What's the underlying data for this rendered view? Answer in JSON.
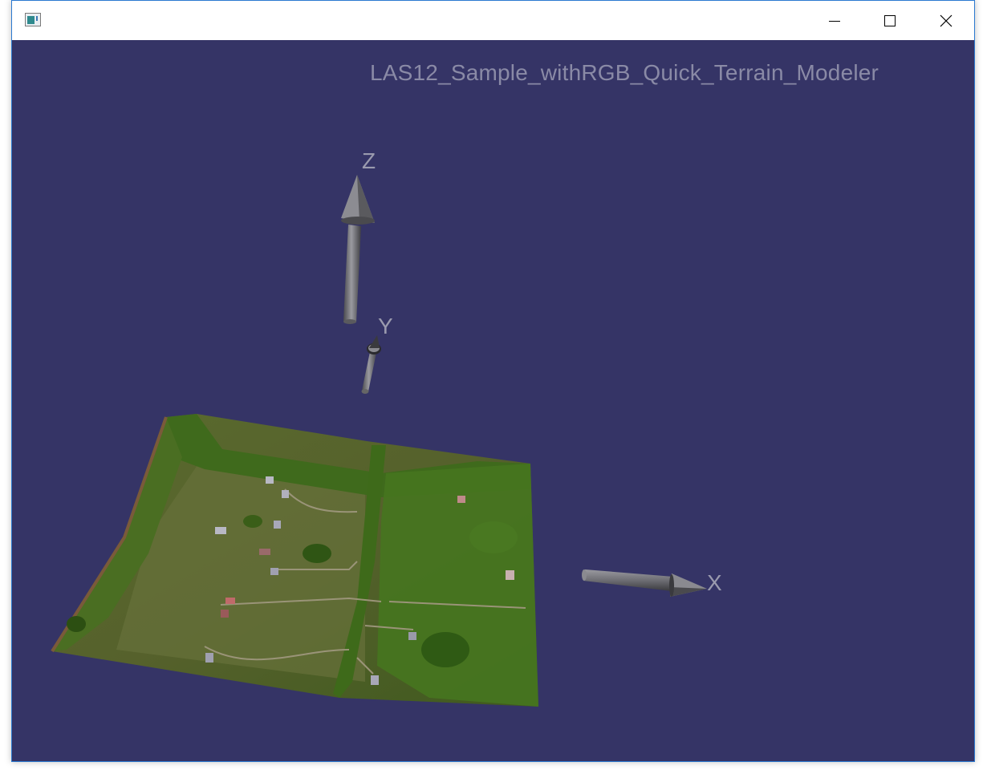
{
  "window": {
    "icon": "app-window-icon",
    "controls": {
      "minimize_icon": "minimize-icon",
      "maximize_icon": "maximize-icon",
      "close_icon": "close-icon"
    }
  },
  "viewport": {
    "title": "LAS12_Sample_withRGB_Quick_Terrain_Modeler",
    "background_color": "#353466",
    "axes": {
      "x_label": "X",
      "y_label": "Y",
      "z_label": "Z"
    }
  }
}
